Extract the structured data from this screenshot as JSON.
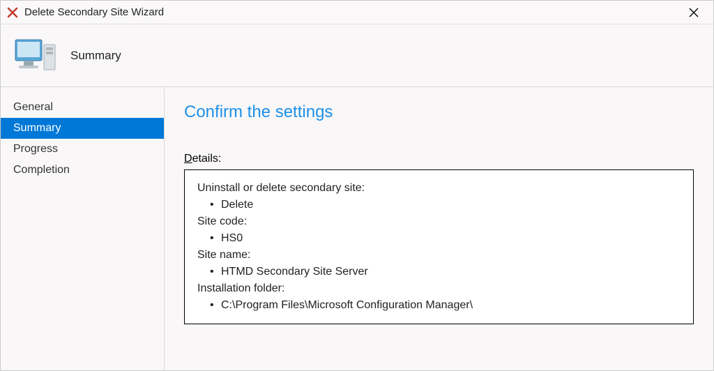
{
  "window": {
    "title": "Delete Secondary Site Wizard"
  },
  "header": {
    "title": "Summary"
  },
  "sidebar": {
    "items": [
      {
        "label": "General",
        "selected": false
      },
      {
        "label": "Summary",
        "selected": true
      },
      {
        "label": "Progress",
        "selected": false
      },
      {
        "label": "Completion",
        "selected": false
      }
    ]
  },
  "content": {
    "heading": "Confirm the settings",
    "details_label_prefix": "D",
    "details_label_rest": "etails:",
    "details": {
      "action_label": "Uninstall or delete secondary site:",
      "action_value": "Delete",
      "site_code_label": "Site code:",
      "site_code_value": "HS0",
      "site_name_label": "Site name:",
      "site_name_value": "HTMD Secondary Site Server",
      "install_folder_label": "Installation folder:",
      "install_folder_value": "C:\\Program Files\\Microsoft Configuration Manager\\"
    }
  }
}
